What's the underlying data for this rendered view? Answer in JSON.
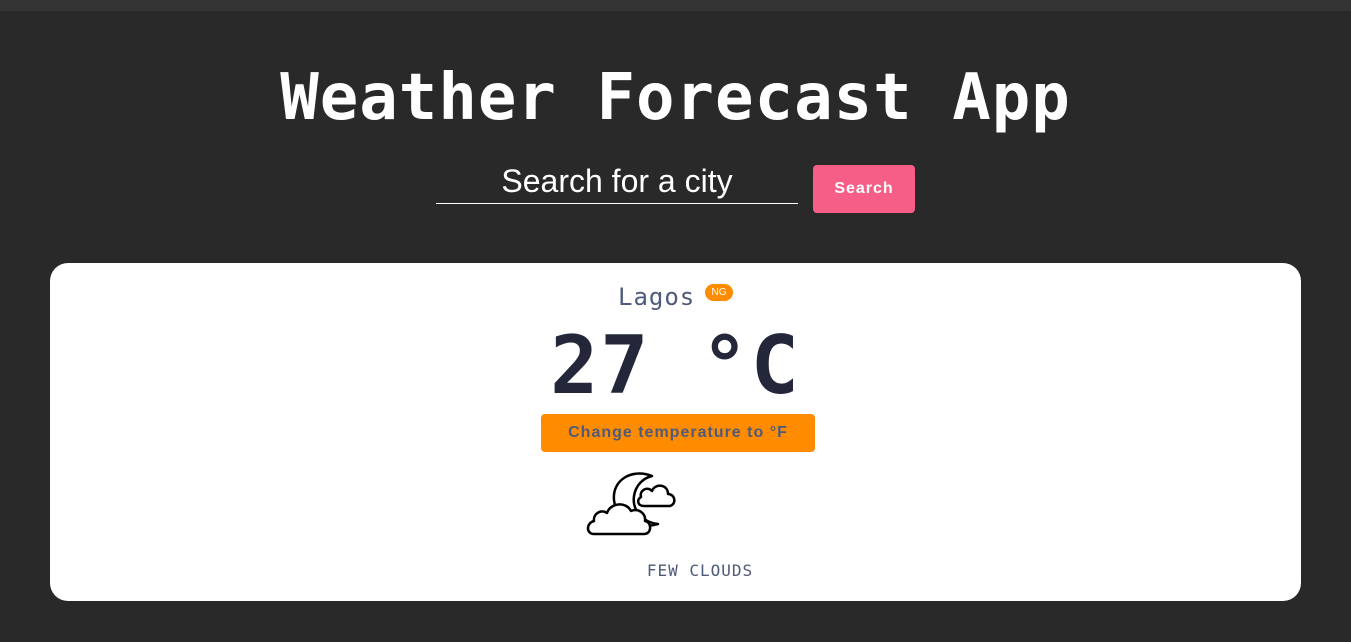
{
  "header": {
    "title": "Weather Forecast App"
  },
  "search": {
    "placeholder": "Search for a city",
    "value": "",
    "button_label": "Search"
  },
  "weather": {
    "city": "Lagos",
    "country_code": "NG",
    "temperature": "27 °C",
    "toggle_label": "Change temperature to °F",
    "icon": "few-clouds-night-icon",
    "description": "FEW CLOUDS"
  },
  "colors": {
    "background": "#292929",
    "card": "#ffffff",
    "search_button": "#f75e87",
    "accent_orange": "#ff8c00",
    "text_muted": "#4e5a7b",
    "text_dark": "#24273a"
  }
}
